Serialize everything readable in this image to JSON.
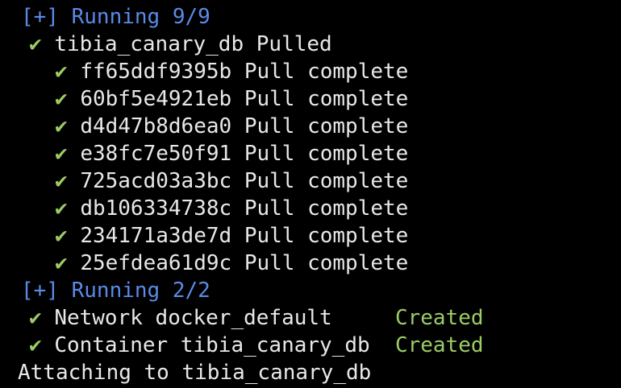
{
  "colors": {
    "background": "#000000",
    "text": "#e8e8e8",
    "header_blue": "#5b8ae8",
    "check_green": "#9ccc65",
    "status_green": "#9ccc65"
  },
  "partial_top_glyph": "_",
  "section1": {
    "header": "[+] Running 9/9",
    "image_line": {
      "check": "✔",
      "name": "tibia_canary_db",
      "status": "Pulled"
    },
    "layers": [
      {
        "check": "✔",
        "id": "ff65ddf9395b",
        "status": "Pull complete"
      },
      {
        "check": "✔",
        "id": "60bf5e4921eb",
        "status": "Pull complete"
      },
      {
        "check": "✔",
        "id": "d4d47b8d6ea0",
        "status": "Pull complete"
      },
      {
        "check": "✔",
        "id": "e38fc7e50f91",
        "status": "Pull complete"
      },
      {
        "check": "✔",
        "id": "725acd03a3bc",
        "status": "Pull complete"
      },
      {
        "check": "✔",
        "id": "db106334738c",
        "status": "Pull complete"
      },
      {
        "check": "✔",
        "id": "234171a3de7d",
        "status": "Pull complete"
      },
      {
        "check": "✔",
        "id": "25efdea61d9c",
        "status": "Pull complete"
      }
    ]
  },
  "section2": {
    "header": "[+] Running 2/2",
    "items": [
      {
        "check": "✔",
        "label": "Network docker_default   ",
        "status": "Created"
      },
      {
        "check": "✔",
        "label": "Container tibia_canary_db",
        "status": "Created"
      }
    ]
  },
  "footer": "Attaching to tibia_canary_db"
}
